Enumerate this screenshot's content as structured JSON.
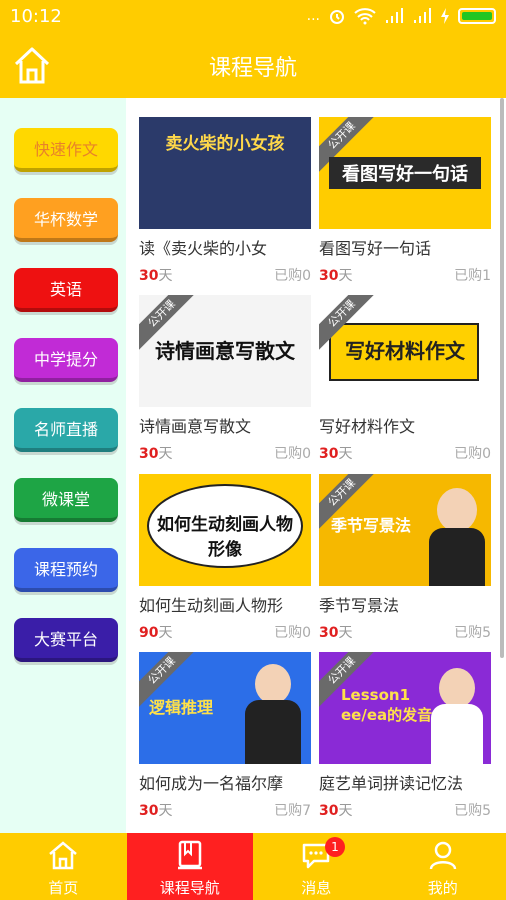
{
  "status_bar": {
    "time": "10:12",
    "dots": "...",
    "icons": [
      "alarm-icon",
      "wifi-icon",
      "signal-icon",
      "signal-icon",
      "charging-icon",
      "battery-icon"
    ]
  },
  "header": {
    "title": "课程导航",
    "home_icon": "home-icon"
  },
  "sidebar": {
    "items": [
      {
        "label": "快速作文",
        "color": "#ffd800",
        "text_color": "#e8822a"
      },
      {
        "label": "华杯数学",
        "color": "#ffa020"
      },
      {
        "label": "英语",
        "color": "#ee1111"
      },
      {
        "label": "中学提分",
        "color": "#c12bd6"
      },
      {
        "label": "名师直播",
        "color": "#2aa8a8"
      },
      {
        "label": "微课堂",
        "color": "#1ea545"
      },
      {
        "label": "课程预约",
        "color": "#3b66e8"
      },
      {
        "label": "大赛平台",
        "color": "#3a1ea8"
      }
    ]
  },
  "courses": [
    {
      "title": "读《卖火柴的小女",
      "days": "30",
      "unit": "天",
      "bought": "已购0",
      "thumb_text": "卖火柴的小女孩",
      "badge": "",
      "bg": "#2b3a6a",
      "fg": "#ffd84a"
    },
    {
      "title": "看图写好一句话",
      "days": "30",
      "unit": "天",
      "bought": "已购1",
      "thumb_text": "看图写好一句话",
      "badge": "公开课",
      "bg": "#ffcc00",
      "fg": "#ffffff"
    },
    {
      "title": "诗情画意写散文",
      "days": "30",
      "unit": "天",
      "bought": "已购0",
      "thumb_text": "诗情画意写散文",
      "badge": "公开课",
      "bg": "#f4f4f4",
      "fg": "#111111"
    },
    {
      "title": "写好材料作文",
      "days": "30",
      "unit": "天",
      "bought": "已购0",
      "thumb_text": "写好材料作文",
      "badge": "公开课",
      "bg": "#ffd000",
      "fg": "#222222"
    },
    {
      "title": "如何生动刻画人物形",
      "days": "90",
      "unit": "天",
      "bought": "已购0",
      "thumb_text": "如何生动刻画人物形像",
      "badge": "",
      "bg": "#ffcc00",
      "fg": "#111111"
    },
    {
      "title": "季节写景法",
      "days": "30",
      "unit": "天",
      "bought": "已购5",
      "thumb_text": "季节写景法",
      "badge": "公开课",
      "bg": "#f6b800",
      "fg": "#ffffff"
    },
    {
      "title": "如何成为一名福尔摩",
      "days": "30",
      "unit": "天",
      "bought": "已购7",
      "thumb_text": "逻辑推理",
      "badge": "公开课",
      "bg": "#2c6ee8",
      "fg": "#ffe14a"
    },
    {
      "title": "庭艺单词拼读记忆法",
      "days": "30",
      "unit": "天",
      "bought": "已购5",
      "thumb_text": "Lesson1 ee/ea的发音",
      "badge": "公开课",
      "bg": "#8a2ad6",
      "fg": "#ffe14a"
    }
  ],
  "tabs": [
    {
      "label": "首页",
      "icon": "home-icon",
      "active": false
    },
    {
      "label": "课程导航",
      "icon": "book-icon",
      "active": true
    },
    {
      "label": "消息",
      "icon": "chat-bubble-icon",
      "active": false,
      "badge": "1"
    },
    {
      "label": "我的",
      "icon": "user-icon",
      "active": false
    }
  ]
}
